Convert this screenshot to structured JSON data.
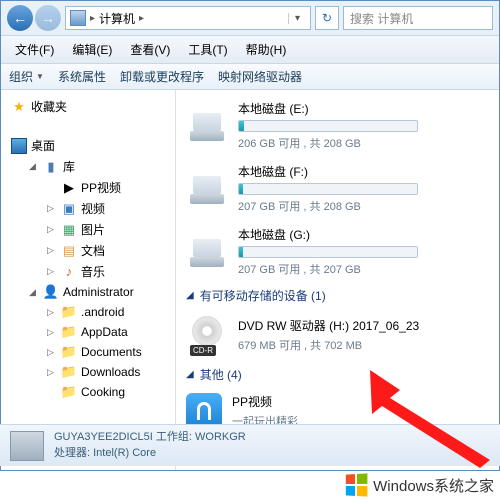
{
  "breadcrumb": {
    "label": "计算机"
  },
  "search": {
    "placeholder": "搜索 计算机"
  },
  "menu": {
    "file": "文件(F)",
    "edit": "编辑(E)",
    "view": "查看(V)",
    "tools": "工具(T)",
    "help": "帮助(H)"
  },
  "toolbar": {
    "organize": "组织",
    "properties": "系统属性",
    "uninstall": "卸载或更改程序",
    "map": "映射网络驱动器"
  },
  "sidebar": {
    "favorites": "收藏夹",
    "desktop": "桌面",
    "libraries": "库",
    "items": [
      {
        "label": "PP视频"
      },
      {
        "label": "视频"
      },
      {
        "label": "图片"
      },
      {
        "label": "文档"
      },
      {
        "label": "音乐"
      }
    ],
    "admin": "Administrator",
    "admin_items": [
      {
        "label": ".android"
      },
      {
        "label": "AppData"
      },
      {
        "label": "Documents"
      },
      {
        "label": "Downloads"
      },
      {
        "label": "Cooking"
      }
    ]
  },
  "drives": [
    {
      "name": "本地磁盘 (E:)",
      "stats": "206 GB 可用 , 共 208 GB",
      "fill": 3
    },
    {
      "name": "本地磁盘 (F:)",
      "stats": "207 GB 可用 , 共 208 GB",
      "fill": 2
    },
    {
      "name": "本地磁盘 (G:)",
      "stats": "207 GB 可用 , 共 207 GB",
      "fill": 2
    }
  ],
  "removable": {
    "header": "有可移动存储的设备 (1)",
    "dvd": {
      "name": "DVD RW 驱动器 (H:) 2017_06_23",
      "badge": "CD-R",
      "stats": "679 MB 可用 , 共 702 MB"
    }
  },
  "other": {
    "header": "其他 (4)",
    "pp": {
      "name": "PP视频",
      "sub": "一起玩出精彩"
    }
  },
  "status": {
    "line1": "GUYA3YEE2DICL5I 工作组: WORKGR",
    "line2": "处理器: Intel(R) Core"
  },
  "watermark": {
    "text": "Windows系统之家"
  }
}
